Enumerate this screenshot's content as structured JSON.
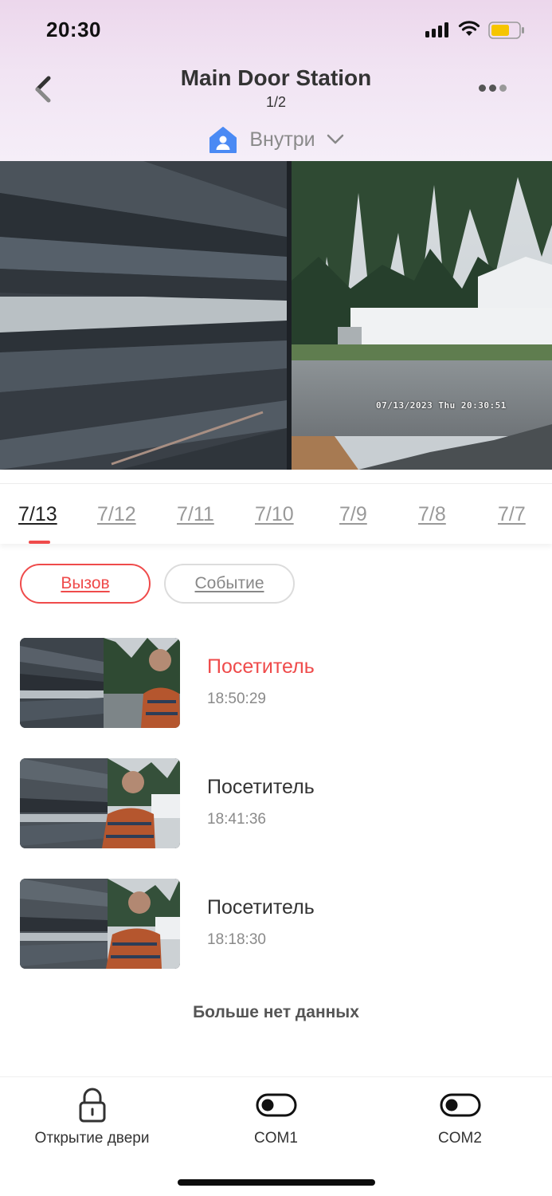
{
  "status_bar": {
    "time": "20:30",
    "battery_color": "#f6c500"
  },
  "header": {
    "title": "Main Door Station",
    "page_indicator": "1/2"
  },
  "location": {
    "label": "Внутри",
    "icon": "home-user-icon",
    "icon_color": "#4a8af4"
  },
  "video": {
    "timestamp": "07/13/2023 Thu 20:30:51"
  },
  "date_tabs": [
    {
      "label": "7/13",
      "active": true
    },
    {
      "label": "7/12"
    },
    {
      "label": "7/11"
    },
    {
      "label": "7/10"
    },
    {
      "label": "7/9"
    },
    {
      "label": "7/8"
    },
    {
      "label": "7/7"
    }
  ],
  "filters": {
    "call": "Вызов",
    "event": "Событие",
    "active": "call"
  },
  "records": [
    {
      "title": "Посетитель",
      "time": "18:50:29",
      "unread": true
    },
    {
      "title": "Посетитель",
      "time": "18:41:36"
    },
    {
      "title": "Посетитель",
      "time": "18:18:30"
    }
  ],
  "no_more_text": "Больше нет данных",
  "bottom_bar": {
    "door_open": "Открытие двери",
    "com1": "COM1",
    "com2": "COM2"
  },
  "colors": {
    "accent": "#ef4b4b",
    "muted": "#8a8a8a"
  }
}
